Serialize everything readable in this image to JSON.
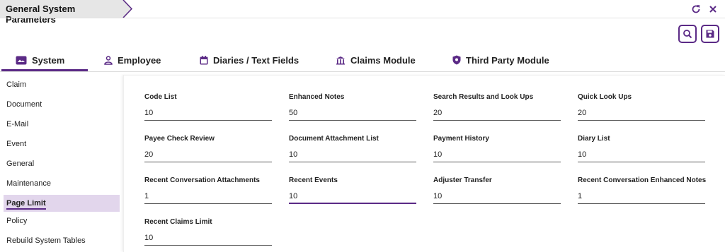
{
  "header": {
    "title": "General System Parameters"
  },
  "colors": {
    "accent": "#5b2a86",
    "active_bg": "#e2d6ec"
  },
  "icons": {
    "refresh": "refresh-icon",
    "close": "close-icon",
    "search": "search-icon",
    "save": "save-icon"
  },
  "tabs": [
    {
      "label": "System",
      "icon": "system-icon",
      "active": true
    },
    {
      "label": "Employee",
      "icon": "person-icon",
      "active": false
    },
    {
      "label": "Diaries / Text Fields",
      "icon": "calendar-icon",
      "active": false
    },
    {
      "label": "Claims Module",
      "icon": "building-icon",
      "active": false
    },
    {
      "label": "Third Party Module",
      "icon": "shield-icon",
      "active": false
    }
  ],
  "sidebar": {
    "items": [
      {
        "label": "Claim"
      },
      {
        "label": "Document"
      },
      {
        "label": "E-Mail"
      },
      {
        "label": "Event"
      },
      {
        "label": "General"
      },
      {
        "label": "Maintenance"
      },
      {
        "label": "Page Limit",
        "active": true
      },
      {
        "label": "Policy"
      },
      {
        "label": "Rebuild System Tables"
      }
    ]
  },
  "fields": [
    {
      "label": "Code List",
      "value": "10"
    },
    {
      "label": "Enhanced Notes",
      "value": "50"
    },
    {
      "label": "Search Results and Look Ups",
      "value": "20"
    },
    {
      "label": "Quick Look Ups",
      "value": "20"
    },
    {
      "label": "Payee Check Review",
      "value": "20"
    },
    {
      "label": "Document Attachment List",
      "value": "10"
    },
    {
      "label": "Payment History",
      "value": "10"
    },
    {
      "label": "Diary List",
      "value": "10"
    },
    {
      "label": "Recent Conversation Attachments",
      "value": "1"
    },
    {
      "label": "Recent Events",
      "value": "10"
    },
    {
      "label": "Adjuster Transfer",
      "value": "10"
    },
    {
      "label": "Recent Conversation Enhanced Notes",
      "value": "1"
    },
    {
      "label": "Recent Claims Limit",
      "value": "10"
    }
  ]
}
